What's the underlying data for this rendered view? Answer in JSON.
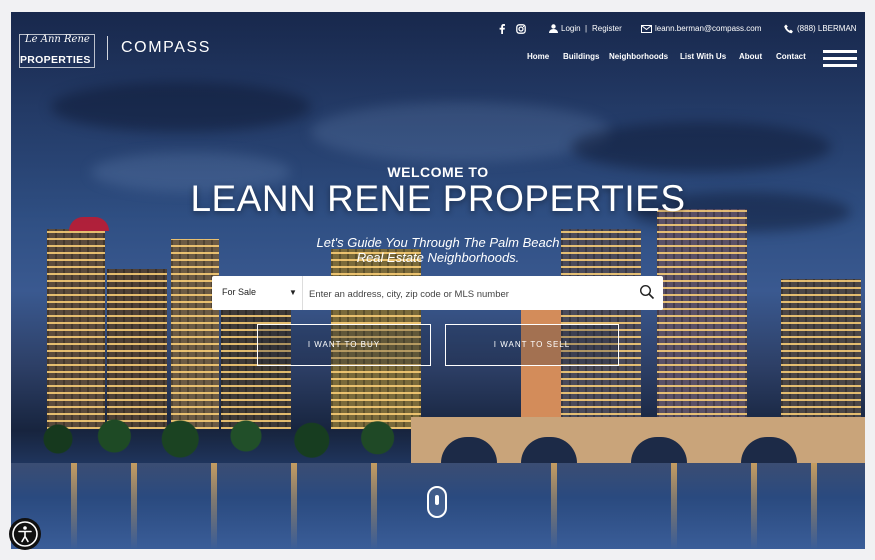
{
  "brand": {
    "logo_script": "Le Ann Rene",
    "logo_properties": "PROPERTIES",
    "partner": "COMPASS"
  },
  "topbar": {
    "login": "Login",
    "separator": "|",
    "register": "Register",
    "email": "leann.berman@compass.com",
    "phone": "(888) LBERMAN"
  },
  "nav": {
    "items": [
      "Home",
      "Buildings",
      "Neighborhoods",
      "List With Us",
      "About",
      "Contact"
    ]
  },
  "hero": {
    "welcome": "WELCOME TO",
    "title": "LEANN RENE PROPERTIES",
    "subtitle_line1": "Let's Guide You Through The Palm Beach",
    "subtitle_line2": "Real Estate Neighborhoods."
  },
  "search": {
    "type_selected": "For Sale",
    "placeholder": "Enter an address, city, zip code or MLS number"
  },
  "cta": {
    "buy": "I WANT TO BUY",
    "sell": "I WANT TO SELL"
  },
  "icons": {
    "facebook": "facebook-icon",
    "instagram": "instagram-icon",
    "user": "user-icon",
    "mail": "mail-icon",
    "phone": "phone-icon",
    "search": "search-icon",
    "menu": "hamburger-menu-icon",
    "scroll": "scroll-indicator-icon",
    "accessibility": "accessibility-icon"
  }
}
